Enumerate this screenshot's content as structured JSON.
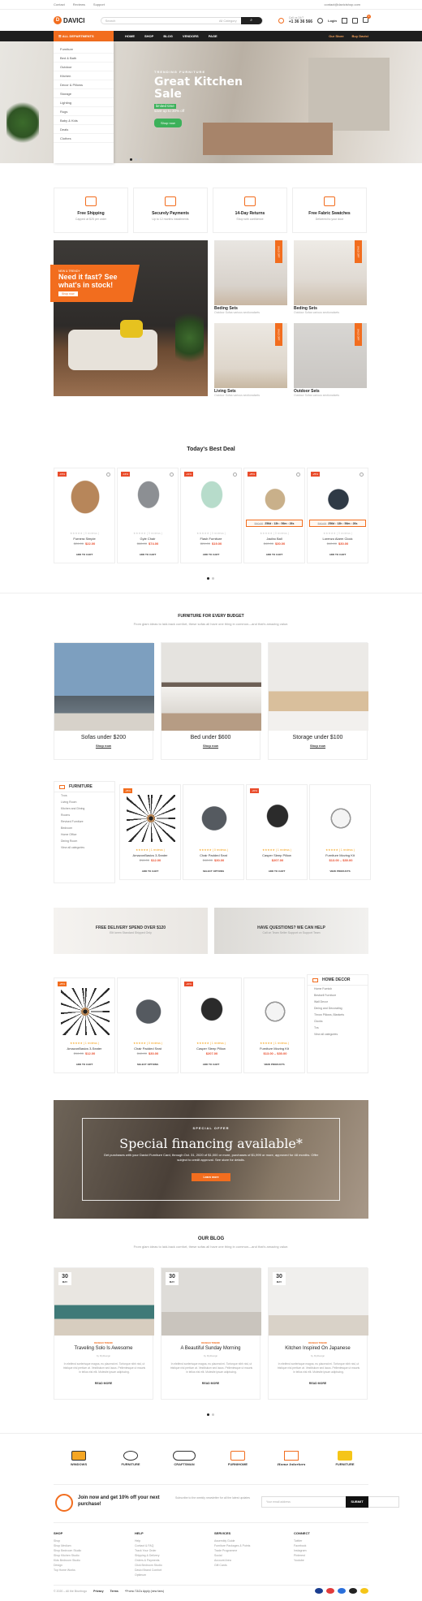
{
  "topbar": {
    "links": [
      "Contact",
      "Reviews",
      "Support"
    ],
    "email": "contact@davicishop.com"
  },
  "header": {
    "logo": "DAVICI",
    "search_placeholder": "Search",
    "category": "All Category",
    "phone_label": "Call us 24/7",
    "phone": "+1 36 36 566",
    "login": "Login",
    "cart_count": "0"
  },
  "nav": {
    "all_categories": "ALL DEPARTMENTS",
    "items": [
      "HOME",
      "SHOP",
      "BLOG",
      "VENDORS",
      "PAGE"
    ],
    "our_store": "Our Store",
    "buy": "Buy Davici"
  },
  "category_menu": [
    "Furniture",
    "Bed & Bath",
    "Outdoor",
    "Kitchen",
    "Decor & Pillows",
    "Storage",
    "Lighting",
    "Rugs",
    "Baby & Kids",
    "Deals",
    "Clothes"
  ],
  "hero": {
    "tag": "TRENDING FURNITURE",
    "title": "Great Kitchen Sale",
    "subtitle": "limited time",
    "sub2": "save up to 30% off",
    "button": "Shop now"
  },
  "features": [
    {
      "title": "Free Shipping",
      "desc": "Capped at $25 per order"
    },
    {
      "title": "Securely Payments",
      "desc": "Up to 12 months installments"
    },
    {
      "title": "14-Day Returns",
      "desc": "Shop with confidence"
    },
    {
      "title": "Free Fabric Swatches",
      "desc": "Delivered to your door"
    }
  ],
  "promo": {
    "small": "NEW & TRENDY",
    "headline": "Need it fast? See what's in stock!",
    "button": "Shop now"
  },
  "tiles": [
    {
      "title": "Beding Sets",
      "sub": "Outdoor Sofas various sectionalsets",
      "ribbon": "SALE OFF"
    },
    {
      "title": "Beding Sets",
      "sub": "Outdoor Sofas various sectionalsets",
      "ribbon": "SALE OFF"
    },
    {
      "title": "Living Sets",
      "sub": "Outdoor Sofas various sectionalsets",
      "ribbon": "SALE OFF"
    },
    {
      "title": "Outdoor Sets",
      "sub": "Outdoor Sofas various sectionalsets",
      "ribbon": "SALE OFF"
    }
  ],
  "best_deal": {
    "title": "Today's Best Deal",
    "products": [
      {
        "name": "Furnera Simple",
        "old": "$26.00",
        "price": "$22.00",
        "reviews": "( 0 reviews )",
        "sale": "-15%",
        "cart": "ADD TO CART"
      },
      {
        "name": "Gyle Chair",
        "old": "$88.00",
        "price": "$74.00",
        "reviews": "( 0 reviews )",
        "sale": "-16%",
        "cart": "ADD TO CART"
      },
      {
        "name": "Flash Furniture",
        "old": "$24.00",
        "price": "$19.00",
        "reviews": "( 0 reviews )",
        "sale": "-21%",
        "cart": "ADD TO CART"
      },
      {
        "name": "Jacibo Ball",
        "old": "$40.00",
        "price": "$30.00",
        "reviews": "( 0 reviews )",
        "sale": "-25%",
        "cart": "ADD TO CART",
        "timer": "256d : 13h : 56m : 26s",
        "timer_old": "$40.00"
      },
      {
        "name": "Lorenzo Alarm Clock",
        "old": "$40.00",
        "price": "$30.00",
        "reviews": "( 0 reviews )",
        "sale": "-25%",
        "cart": "ADD TO CART",
        "timer": "256d : 13h : 56m : 26s",
        "timer_old": "$40.00"
      }
    ]
  },
  "budget": {
    "title": "FURNITURE FOR EVERY BUDGET",
    "sub": "From glam ideas to laid-back comfort, these sofas all have one thing in common—and that's amazing value.",
    "cards": [
      {
        "title": "Sofas under $200",
        "link": "Shop now"
      },
      {
        "title": "Bed under $600",
        "link": "Shop now"
      },
      {
        "title": "Storage under $100",
        "link": "Shop now"
      }
    ]
  },
  "furniture_block": {
    "title": "FURNITURE",
    "links": [
      "Tvos",
      "Living Room",
      "Kitchen and Dining",
      "Rooms",
      "Revised Furniture",
      "Bedroom",
      "Home Office",
      "Dining Room",
      "View all categories"
    ],
    "products": [
      {
        "name": "AmazonBasics 3-Seater",
        "old": "$16.00",
        "price": "$12.00",
        "reviews": "( 1 reviews )",
        "sale": "-25%",
        "cart": "ADD TO CART"
      },
      {
        "name": "Chair Padded Seat",
        "old": "$48.00",
        "price": "$30.00",
        "reviews": "( 0 reviews )",
        "sale": "",
        "cart": "SELECT OPTIONS"
      },
      {
        "name": "Casper Sleep Pillow",
        "old": "",
        "price": "$207.00",
        "reviews": "( 1 reviews )",
        "sale": "-20%",
        "cart": "ADD TO CART"
      },
      {
        "name": "Furniture Moving Kit",
        "old": "",
        "price": "$13.00 – $30.00",
        "reviews": "( 1 reviews )",
        "sale": "",
        "cart": "VIEW PRODUCTS"
      }
    ]
  },
  "banners": [
    {
      "title": "FREE DELIVERY SPEND OVER $120",
      "desc": "Elit lorem Standard Shipped Only"
    },
    {
      "title": "HAVE QUESTIONS? WE CAN HELP",
      "desc": "Call on Team Seller Support on Support Team"
    }
  ],
  "decor_block": {
    "title": "HOME DECOR",
    "links": [
      "Home Furnish",
      "Bestsell Furniture",
      "Wall Decor",
      "Dining and Decorating",
      "Throw Pillows, Blankets",
      "Clocks",
      "Tvs",
      "View all categories"
    ],
    "products": [
      {
        "name": "AmazonBasics 3-Seater",
        "old": "$16.00",
        "price": "$12.00",
        "reviews": "( 1 reviews )",
        "sale": "-25%",
        "cart": "ADD TO CART"
      },
      {
        "name": "Chair Padded Seat",
        "old": "$48.00",
        "price": "$30.00",
        "reviews": "( 0 reviews )",
        "sale": "",
        "cart": "SELECT OPTIONS"
      },
      {
        "name": "Casper Sleep Pillow",
        "old": "",
        "price": "$207.00",
        "reviews": "( 1 reviews )",
        "sale": "-20%",
        "cart": "ADD TO CART"
      },
      {
        "name": "Furniture Moving Kit",
        "old": "",
        "price": "$13.00 – $30.00",
        "reviews": "( 1 reviews )",
        "sale": "",
        "cart": "VIEW PRODUCTS"
      }
    ]
  },
  "special": {
    "tag": "SPECIAL OFFER",
    "title": "Special financing available*",
    "desc": "Get purchases with your Davici Furniture Card, through Oct. 31, 2020 of $1,000 or more, purchases of $1,999 or more, approved for 48 months. Offer subject to credit approval. See store for details.",
    "button": "Learn more"
  },
  "blog": {
    "title": "OUR BLOG",
    "sub": "From glam ideas to laid-back comfort, these sofas all have one thing in common—and that's amazing value.",
    "posts": [
      {
        "day": "30",
        "month": "MAY",
        "cat": "DESIGN TREND",
        "title": "Traveling Solo Is Awesome",
        "by": "by MyDesign",
        "excerpt": "In eleifend scelerisque magna, eu placerat mi. Tortorque nibh nisl, ut tristique nisl pretium at. Vestibulum sed lacus. Pellentesque ut mauris in tellus nisl elit. Molestie ipsum adipiscing.",
        "more": "READ MORE"
      },
      {
        "day": "30",
        "month": "MAY",
        "cat": "DESIGN TREND",
        "title": "A Beautiful Sunday Morning",
        "by": "by MyDesign",
        "excerpt": "In eleifend scelerisque magna, eu placerat mi. Tortorque nibh nisl, ut tristique nisl pretium at. Vestibulum sed lacus. Pellentesque ut mauris in tellus nisl elit. Molestie ipsum adipiscing.",
        "more": "READ MORE"
      },
      {
        "day": "30",
        "month": "MAY",
        "cat": "DESIGN TREND",
        "title": "Kitchen Inspired On Japanese",
        "by": "by MyDesign",
        "excerpt": "In eleifend scelerisque magna, eu placerat mi. Tortorque nibh nisl, ut tristique nisl pretium at. Vestibulum sed lacus. Pellentesque ut mauris in tellus nisl elit. Molestie ipsum adipiscing.",
        "more": "READ MORE"
      }
    ]
  },
  "brands": [
    "WINDOWS",
    "FURNITURE",
    "CRAFTSMAN",
    "FURNIHOME",
    "Home Interiors",
    "FURNITURE"
  ],
  "newsletter": {
    "title": "Join now and get 10% off your next purchase!",
    "desc": "Subscribe to the weekly newsletter for all the latest updates",
    "placeholder": "Your email address",
    "button": "SUBMIT"
  },
  "footer": {
    "cols": [
      {
        "h": "SHOP",
        "links": [
          "Shop",
          "Shop Medium",
          "Shop Bedroom Studio",
          "Shop Kitchen Studio",
          "Kids Bedroom Studio",
          "Design",
          "Top Home Works"
        ]
      },
      {
        "h": "HELP",
        "links": [
          "Help",
          "Contact & FAQ",
          "Track Your Order",
          "Shipping & Delivery",
          "Orders & Payments",
          "Click Bedroom Studio",
          "Davici Brand Comfort",
          "Optimum"
        ]
      },
      {
        "h": "SERVICES",
        "links": [
          "Assembly Guide",
          "Furniture Packages & Points",
          "Trade Programme",
          "Social",
          "Account Area",
          "Gift Cards"
        ]
      },
      {
        "h": "CONNECT",
        "links": [
          "Twitter",
          "Facebook",
          "Instagram",
          "Pinterest",
          "Youtube"
        ]
      }
    ],
    "copyright": "© 2020 – All the Bruntrogo",
    "privacy": "Privacy",
    "terms": "Terms",
    "promo_note": "*Promo T&Cs Apply (new fans)"
  },
  "colors": {
    "accent": "#f26d1e",
    "dark": "#1f1f1f",
    "sale": "#e94c2b",
    "green": "#3cb15a"
  }
}
